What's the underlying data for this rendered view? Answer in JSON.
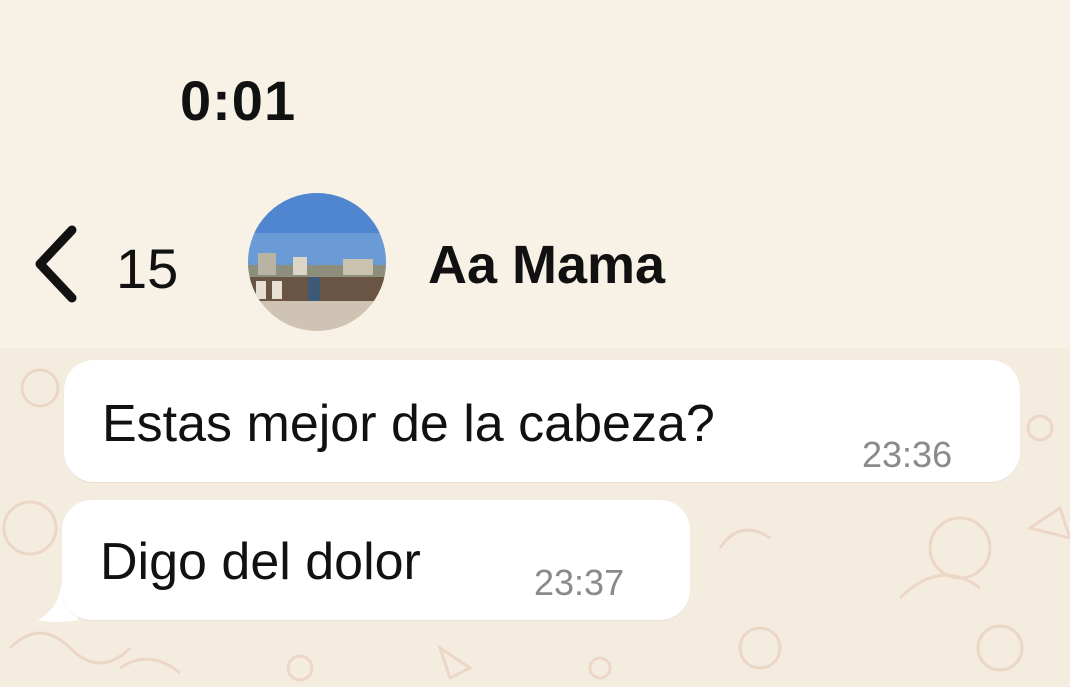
{
  "status_bar": {
    "time": "0:01"
  },
  "header": {
    "back_count": "15",
    "contact_name": "Aa Mama",
    "avatar_icon": "contact-photo-avatar"
  },
  "messages": [
    {
      "text": "Estas mejor de la cabeza?",
      "time": "23:36"
    },
    {
      "text": "Digo del dolor",
      "time": "23:37"
    }
  ],
  "colors": {
    "background": "#f7efe2",
    "bubble": "#ffffff",
    "text": "#111111",
    "timestamp": "#8a8a8a"
  }
}
